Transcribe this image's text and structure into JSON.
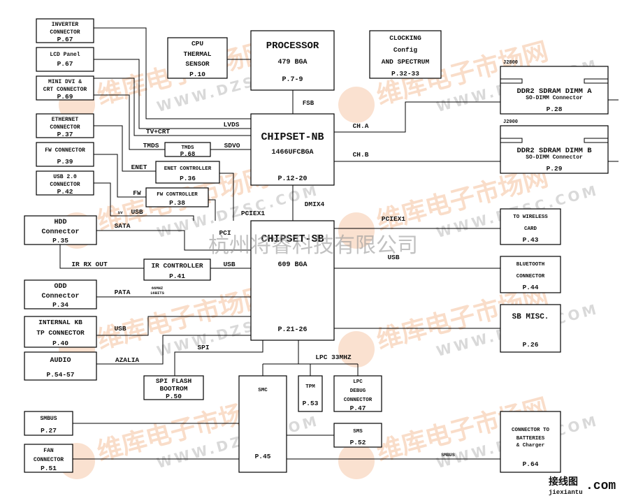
{
  "blocks": {
    "inverter": [
      "INVERTER",
      "CONNECTOR",
      "P.67"
    ],
    "lcd": [
      "LCD Panel",
      "P.67"
    ],
    "minidvi": [
      "MINI DVI &",
      "CRT CONNECTOR",
      "P.69"
    ],
    "ethernet": [
      "ETHERNET",
      "CONNECTOR",
      "P.37"
    ],
    "fwconn": [
      "FW CONNECTOR",
      "P.39"
    ],
    "usb20": [
      "USB 2.0",
      "CONNECTOR",
      "P.42"
    ],
    "hdd": [
      "HDD",
      "Connector",
      "P.35"
    ],
    "odd": [
      "ODD",
      "Connector",
      "P.34"
    ],
    "kb": [
      "INTERNAL KB",
      "TP CONNECTOR",
      "P.40"
    ],
    "audio": [
      "AUDIO",
      "P.54-57"
    ],
    "smbus": [
      "SMBUS",
      "P.27"
    ],
    "fan": [
      "FAN",
      "CONNECTOR",
      "P.51"
    ],
    "cputherm": [
      "CPU",
      "THERMAL",
      "SENSOR",
      "P.10"
    ],
    "processor": [
      "PROCESSOR",
      "479 BGA",
      "P.7-9"
    ],
    "nb": [
      "CHIPSET-NB",
      "1466UFCBGA",
      "P.12-20"
    ],
    "sb": [
      "CHIPSET-SB",
      "609 BGA",
      "P.21-26"
    ],
    "tmds": [
      "TMDS",
      "P.68"
    ],
    "enetctl": [
      "ENET CONTROLLER",
      "P.36"
    ],
    "fwctl": [
      "FW CONTROLLER",
      "P.38"
    ],
    "irctl": [
      "IR CONTROLLER",
      "P.41"
    ],
    "spiflash": [
      "SPI FLASH",
      "BOOTROM",
      "P.50"
    ],
    "smc": [
      "SMC",
      "P.45"
    ],
    "tpm": [
      "TPM",
      "P.53"
    ],
    "lpcdebug": [
      "LPC",
      "DEBUG",
      "CONNECTOR",
      "P.47"
    ],
    "sms": [
      "SMS",
      "P.52"
    ],
    "clocking": [
      "CLOCKING",
      "Config",
      "AND SPECTRUM",
      "P.32-33"
    ],
    "dimma": [
      "DDR2 SDRAM DIMM A",
      "SO-DIMM Connector",
      "P.28"
    ],
    "dimmb": [
      "DDR2 SDRAM DIMM B",
      "SO-DIMM Connector",
      "P.29"
    ],
    "wireless": [
      "TO WIRELESS",
      "CARD",
      "P.43"
    ],
    "bluetooth": [
      "BLUETOOTH",
      "CONNECTOR",
      "P.44"
    ],
    "sbmisc": [
      "SB MISC.",
      "P.26"
    ],
    "battery": [
      "CONNECTOR TO",
      "BATTERIES",
      "& Charger",
      "P.64"
    ]
  },
  "refdes": {
    "dimma": "J2800",
    "dimmb": "J2900"
  },
  "buses": {
    "fsb": "FSB",
    "lvds": "LVDS",
    "tvcrt": "TV+CRT",
    "tmds": "TMDS",
    "sdvo": "SDVO",
    "enet": "ENET",
    "fw": "FW",
    "sv": "sv",
    "usb1": "USB",
    "cha": "CH.A",
    "chb": "CH.B",
    "pciex1a": "PCIEX1",
    "dmix4": "DMIX4",
    "pciex1b": "PCIEX1",
    "pci": "PCI",
    "sata": "SATA",
    "irrx": "IR RX OUT",
    "usb2": "USB",
    "usb3": "USB",
    "pata": "PATA",
    "pata_note1": "66MHZ",
    "pata_note2": "16BITS",
    "usb4": "USB",
    "spi": "SPI",
    "azalia": "AZALIA",
    "lpc": "LPC 33MHZ",
    "smbus": "SMBUS"
  },
  "watermarks": {
    "brand": "维库电子市场网",
    "url": "WWW.DZSC.COM",
    "company": "杭州将睿科技有限公司",
    "corner_logo": "接线图",
    "corner_url": "jiexiantu",
    "corner_com": ".com"
  }
}
